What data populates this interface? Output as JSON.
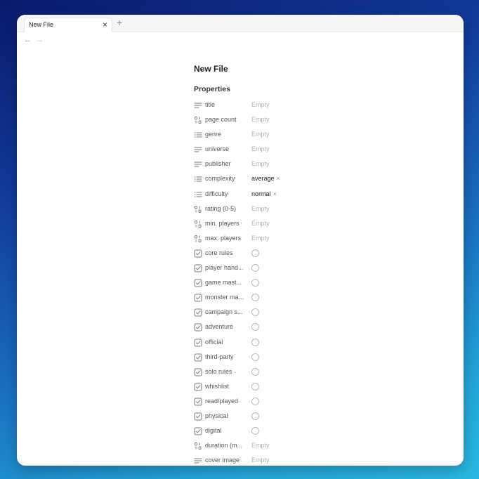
{
  "tab": {
    "title": "New File",
    "close": "×",
    "new_tab": "+"
  },
  "nav": {
    "back": "←",
    "forward": "→"
  },
  "document": {
    "title": "New File",
    "section": "Properties"
  },
  "properties": [
    {
      "label": "title",
      "value": "Empty",
      "icon": "text-lines-icon",
      "kind": "text"
    },
    {
      "label": "page count",
      "value": "Empty",
      "icon": "number-icon",
      "kind": "text"
    },
    {
      "label": "genre",
      "value": "Empty",
      "icon": "list-icon",
      "kind": "text"
    },
    {
      "label": "universe",
      "value": "Empty",
      "icon": "text-lines-icon",
      "kind": "text"
    },
    {
      "label": "publisher",
      "value": "Empty",
      "icon": "text-lines-icon",
      "kind": "text"
    },
    {
      "label": "complexity",
      "value": "average",
      "remove": "×",
      "icon": "list-icon",
      "kind": "chip"
    },
    {
      "label": "difficulty",
      "value": "normal",
      "remove": "×",
      "icon": "list-icon",
      "kind": "chip"
    },
    {
      "label": "rating (0-5)",
      "value": "Empty",
      "icon": "number-icon",
      "kind": "text"
    },
    {
      "label": "min. players",
      "value": "Empty",
      "icon": "number-icon",
      "kind": "text"
    },
    {
      "label": "max. players",
      "value": "Empty",
      "icon": "number-icon",
      "kind": "text"
    },
    {
      "label": "core rules",
      "icon": "checkbox-icon",
      "kind": "check"
    },
    {
      "label": "player hand...",
      "icon": "checkbox-icon",
      "kind": "check"
    },
    {
      "label": "game mast...",
      "icon": "checkbox-icon",
      "kind": "check"
    },
    {
      "label": "monster ma...",
      "icon": "checkbox-icon",
      "kind": "check"
    },
    {
      "label": "campaign s...",
      "icon": "checkbox-icon",
      "kind": "check"
    },
    {
      "label": "adventure",
      "icon": "checkbox-icon",
      "kind": "check"
    },
    {
      "label": "official",
      "icon": "checkbox-icon",
      "kind": "check"
    },
    {
      "label": "third-party",
      "icon": "checkbox-icon",
      "kind": "check"
    },
    {
      "label": "solo rules",
      "icon": "checkbox-icon",
      "kind": "check"
    },
    {
      "label": "whishlist",
      "icon": "checkbox-icon",
      "kind": "check"
    },
    {
      "label": "read/played",
      "icon": "checkbox-icon",
      "kind": "check"
    },
    {
      "label": "physical",
      "icon": "checkbox-icon",
      "kind": "check"
    },
    {
      "label": "digital",
      "icon": "checkbox-icon",
      "kind": "check"
    },
    {
      "label": "duration (m...",
      "value": "Empty",
      "icon": "number-icon",
      "kind": "text"
    },
    {
      "label": "cover image",
      "value": "Empty",
      "icon": "text-lines-icon",
      "kind": "text"
    }
  ]
}
